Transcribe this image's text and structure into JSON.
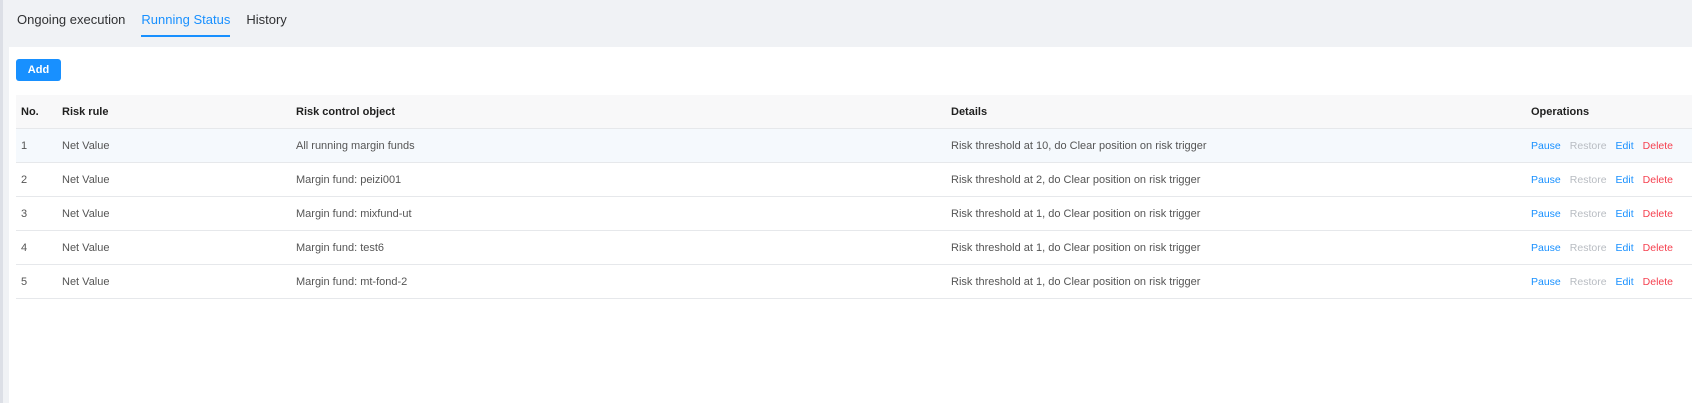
{
  "tabs": [
    {
      "label": "Ongoing execution",
      "active": false
    },
    {
      "label": "Running Status",
      "active": true
    },
    {
      "label": "History",
      "active": false
    }
  ],
  "toolbar": {
    "add_label": "Add"
  },
  "table": {
    "headers": {
      "no": "No.",
      "rule": "Risk rule",
      "object": "Risk control object",
      "details": "Details",
      "operations": "Operations"
    },
    "rows": [
      {
        "no": "1",
        "rule": "Net Value",
        "object": "All running margin funds",
        "details": "Risk threshold at 10, do Clear position on risk trigger"
      },
      {
        "no": "2",
        "rule": "Net Value",
        "object": "Margin fund: peizi001",
        "details": "Risk threshold at 2, do Clear position on risk trigger"
      },
      {
        "no": "3",
        "rule": "Net Value",
        "object": "Margin fund: mixfund-ut",
        "details": "Risk threshold at 1, do Clear position on risk trigger"
      },
      {
        "no": "4",
        "rule": "Net Value",
        "object": "Margin fund: test6",
        "details": "Risk threshold at 1, do Clear position on risk trigger"
      },
      {
        "no": "5",
        "rule": "Net Value",
        "object": "Margin fund: mt-fond-2",
        "details": "Risk threshold at 1, do Clear position on risk trigger"
      }
    ],
    "ops": {
      "pause": "Pause",
      "restore": "Restore",
      "edit": "Edit",
      "delete": "Delete"
    }
  },
  "colors": {
    "accent": "#1890ff",
    "danger": "#f5404f",
    "disabled": "#b8bcc2",
    "page_bg": "#f0f2f5"
  }
}
